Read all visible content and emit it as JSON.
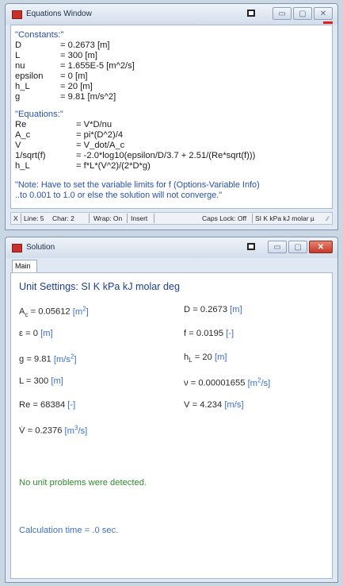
{
  "equations_window": {
    "title": "Equations Window",
    "restore_icon": "restore-icon",
    "buttons": {
      "minimize": "minimize-icon",
      "maximize": "maximize-icon",
      "close": "close-icon"
    },
    "minimize_glyph": "▭",
    "maximize_glyph": "▢",
    "close_glyph": "✕",
    "lines": {
      "constants_label": "\"Constants:\"",
      "c1_name": "D",
      "c1_value": "= 0.2673 [m]",
      "c2_name": "L",
      "c2_value": "= 300 [m]",
      "c3_name": "nu",
      "c3_value": "= 1.655E-5 [m^2/s]",
      "c4_name": "epsilon",
      "c4_value": "= 0 [m]",
      "c5_name": "h_L",
      "c5_value": "= 20 [m]",
      "c6_name": "g",
      "c6_value": "= 9.81 [m/s^2]",
      "equations_label": "\"Equations:\"",
      "e1_name": "Re",
      "e1_value": "= V*D/nu",
      "e2_name": "A_c",
      "e2_value": "= pi*(D^2)/4",
      "e3_name": "V",
      "e3_value": "= V_dot/A_c",
      "e4_name": "1/sqrt(f)",
      "e4_value": "= -2.0*log10(epsilon/D/3.7 + 2.51/(Re*sqrt(f)))",
      "e5_name": "h_L",
      "e5_value": "= f*L*(V^2)/(2*D*g)",
      "note1": "\"Note: Have to set the variable limits for f (Options-Variable Info)",
      "note2": "..to 0.001 to 1.0 or else the solution will not converge.\""
    },
    "status": {
      "x": "X",
      "line": "Line: 5",
      "char": "Char: 2",
      "wrap": "Wrap: On",
      "insert": "Insert",
      "caps": "Caps Lock: Off",
      "units": "SI K kPa kJ molar µ",
      "grip": "∕∕"
    }
  },
  "solution_window": {
    "title": "Solution",
    "restore_icon": "restore-icon",
    "buttons": {
      "minimize": "minimize-icon",
      "maximize": "maximize-icon",
      "close": "close-icon"
    },
    "minimize_glyph": "▭",
    "maximize_glyph": "▢",
    "close_glyph": "✕",
    "tab": "Main",
    "heading": "Unit Settings: SI K kPa kJ molar deg",
    "vars": {
      "ac_name": "A",
      "ac_sub": "c",
      "ac_val": " = 0.05612 ",
      "ac_unit": "[m",
      "ac_exp": "2",
      "ac_unit_end": "]",
      "d_val": "D = 0.2673 ",
      "d_unit": "[m]",
      "eps_val": "ε = 0 ",
      "eps_unit": "[m]",
      "f_val": "f = 0.0195 ",
      "f_unit": "[-]",
      "g_val": "g = 9.81  ",
      "g_unit": "[m/s",
      "g_exp": "2",
      "g_unit_end": "]",
      "hl_name": "h",
      "hl_sub": "L",
      "hl_val": " = 20 ",
      "hl_unit": "[m]",
      "l_val": "L = 300 ",
      "l_unit": "[m]",
      "nu_val": "ν = 0.00001655  ",
      "nu_unit": "[m",
      "nu_exp": "2",
      "nu_unit_end": "/s]",
      "re_val": "Re = 68384  ",
      "re_unit": "[-]",
      "v_val": "V = 4.234 ",
      "v_unit": "[m/s]",
      "vdot_name": "V̇",
      "vdot_val": " = 0.2376 ",
      "vdot_unit": "[m",
      "vdot_exp": "3",
      "vdot_unit_end": "/s]"
    },
    "no_unit_problems": "No unit problems were detected.",
    "calc_time": "Calculation time = .0 sec."
  }
}
